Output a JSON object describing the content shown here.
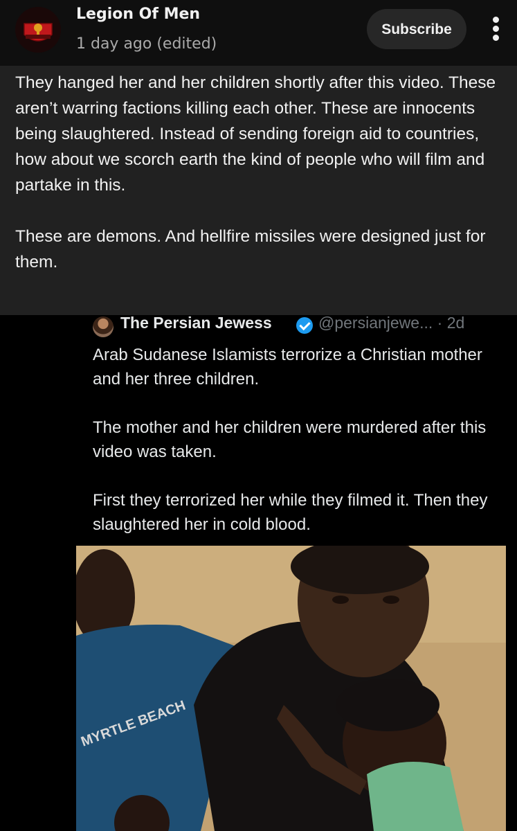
{
  "post": {
    "channel_name": "Legion Of Men",
    "avatar_text": "LEGION OF MEN",
    "time": "1 day ago (edited)",
    "subscribe_label": "Subscribe",
    "more_icon": "more-vert-icon",
    "text": "They hanged her and her children shortly after this video. These aren’t warring factions killing each other. These are innocents being slaughtered. Instead of sending foreign aid to countries, how about we scorch earth the kind of people who will film and partake in this.\n\nThese are demons. And hellfire missiles were designed just for them."
  },
  "embedded_tweet": {
    "author": "The Persian Jewess",
    "verified_icon": "verified-badge-icon",
    "handle": "@persianjewe... · 2d",
    "text": "Arab Sudanese Islamists terrorize a Christian mother and her three children.\n\nThe mother and her children were murdered after this video was taken.\n\nFirst they terrorized her while they filmed it. Then they slaughtered her in cold blood.",
    "video_shirt_text": "MYRTLE BEACH"
  },
  "colors": {
    "background": "#0f0f0f",
    "post_body": "#212121",
    "subscribe_bg": "#272727",
    "verified": "#1d9bf0"
  }
}
